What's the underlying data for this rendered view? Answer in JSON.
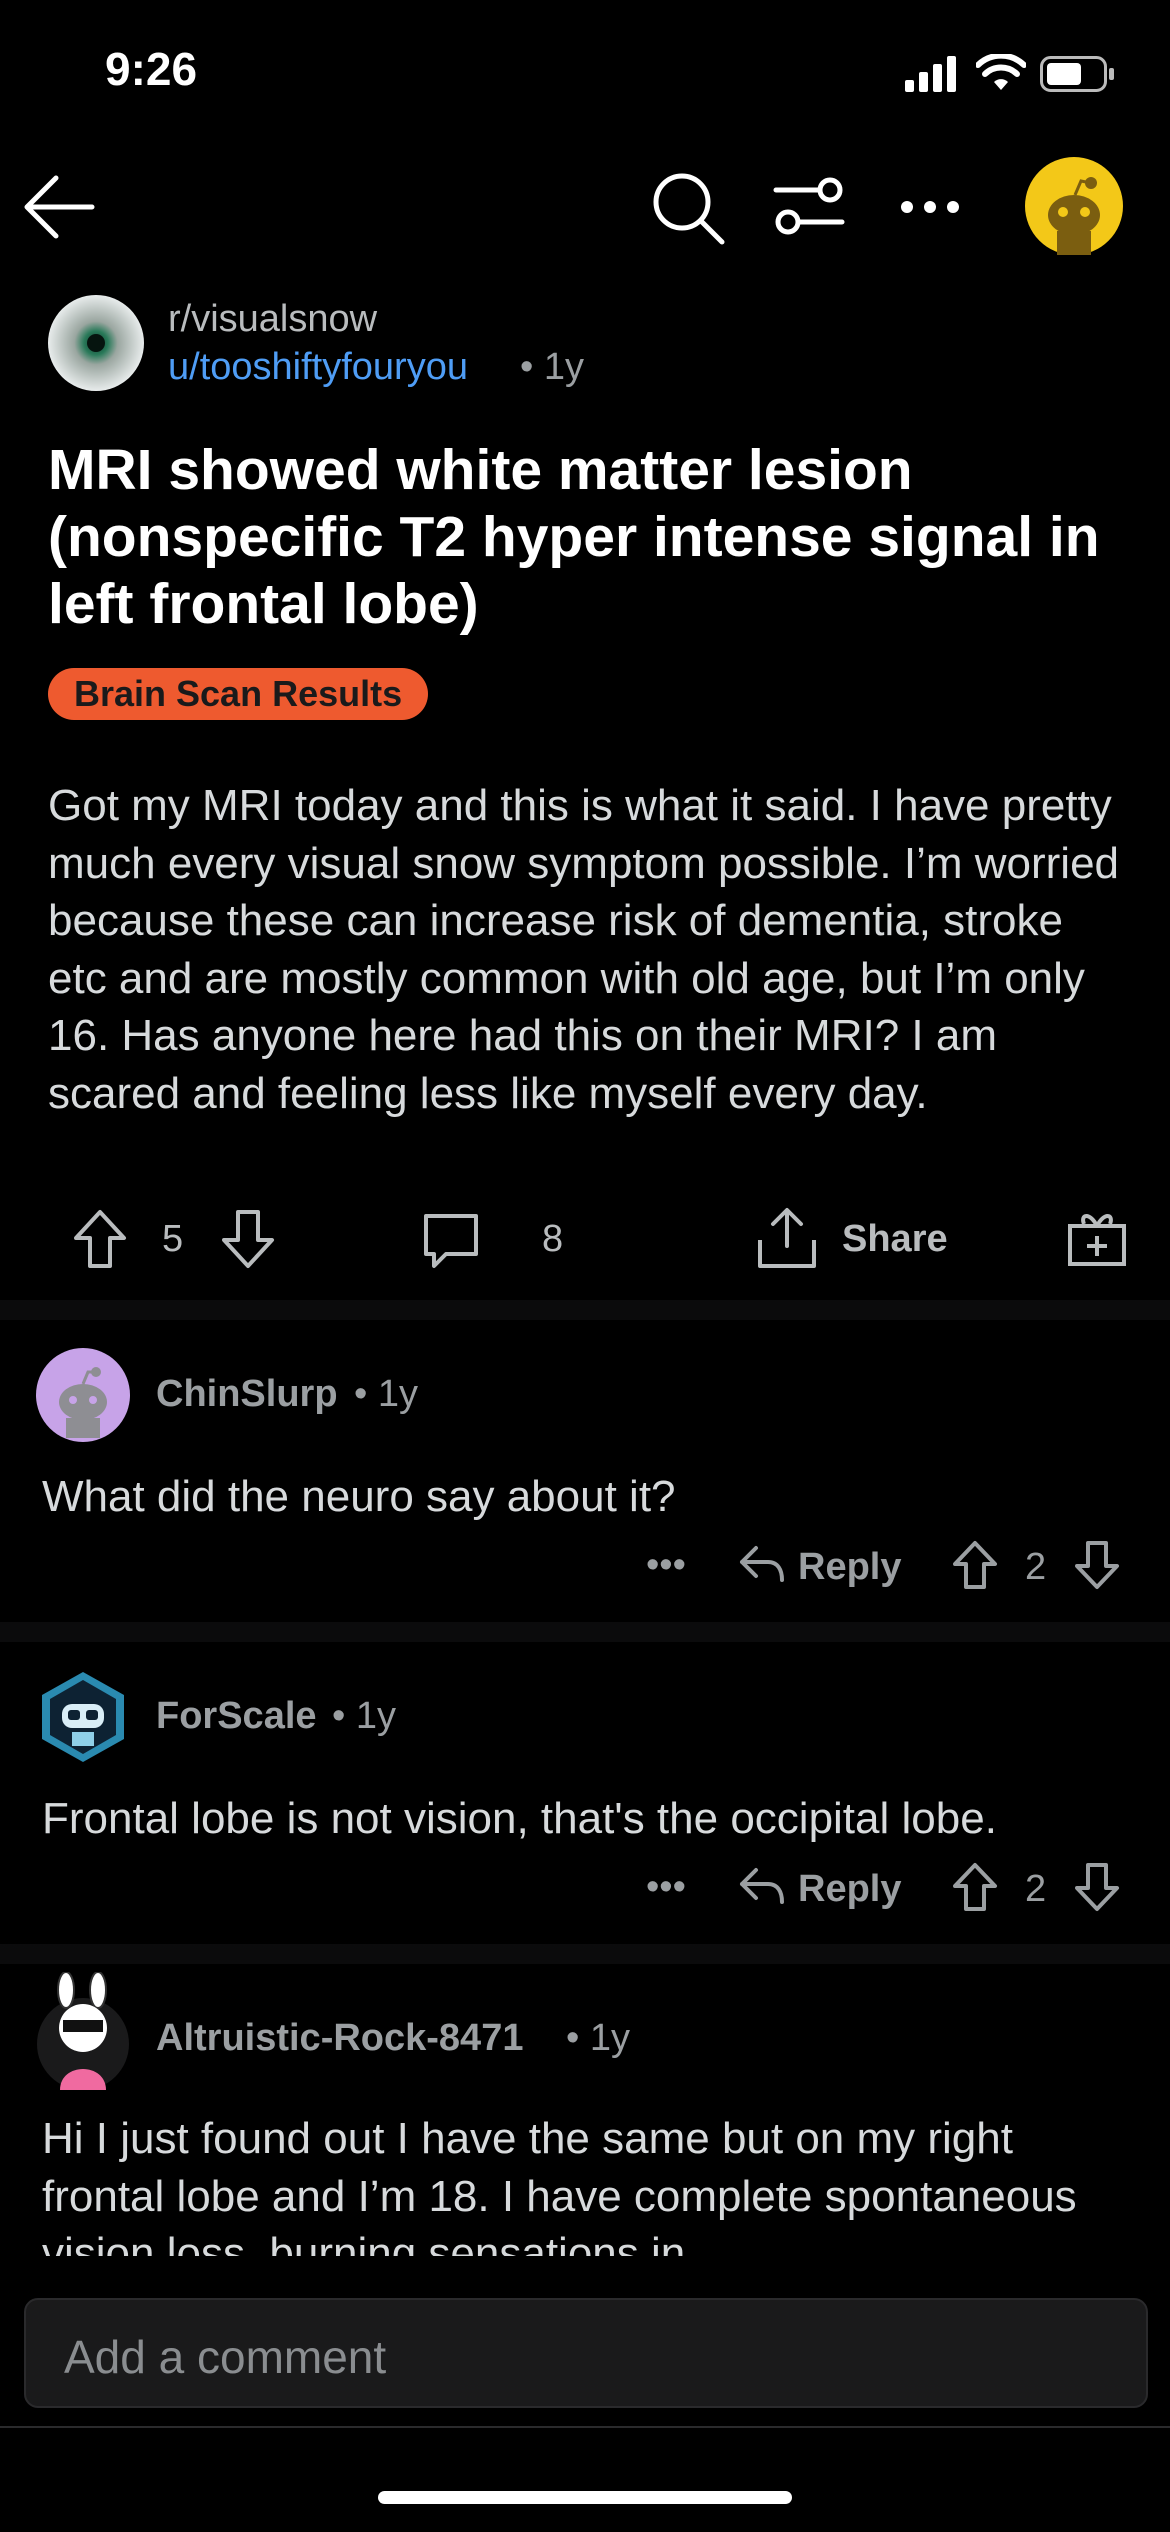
{
  "status": {
    "time": "9:26"
  },
  "nav": {
    "icons": [
      "back-arrow-icon",
      "search-icon",
      "filter-icon",
      "more-icon",
      "avatar"
    ]
  },
  "post": {
    "subreddit": "r/visualsnow",
    "author": "u/tooshiftyfouryou",
    "age": "• 1y",
    "title": "MRI showed white matter lesion (nonspecific T2 hyper intense signal in left frontal lobe)",
    "flair": "Brain Scan Results",
    "body": "Got my MRI today and this is what it said. I have pretty much every visual snow symptom possible. I’m worried because these can increase risk of dementia, stroke etc and are mostly common with old age, but I’m only 16. Has anyone here had this on their MRI? I am scared and feeling less like myself every day.",
    "votes": "5",
    "comments": "8",
    "share_label": "Share"
  },
  "comments": [
    {
      "user": "ChinSlurp",
      "age": "• 1y",
      "body": "What did the neuro say about it?",
      "reply_label": "Reply",
      "votes": "2",
      "more": "•••"
    },
    {
      "user": "ForScale",
      "age": "• 1y",
      "body": "Frontal lobe is not vision, that's the occipital lobe.",
      "reply_label": "Reply",
      "votes": "2",
      "more": "•••"
    },
    {
      "user": "Altruistic-Rock-8471",
      "age": "• 1y",
      "body": "Hi I just found out I have the same but on my right frontal lobe and I’m 18. I have complete spontaneous vision loss, burning sensations in"
    }
  ],
  "composer": {
    "placeholder": "Add a comment"
  },
  "colors": {
    "accent_link": "#4f9df5",
    "flair_bg": "#ee5a2f",
    "avatar_yellow": "#f3c818",
    "avatar_purple": "#c7a3e8"
  }
}
